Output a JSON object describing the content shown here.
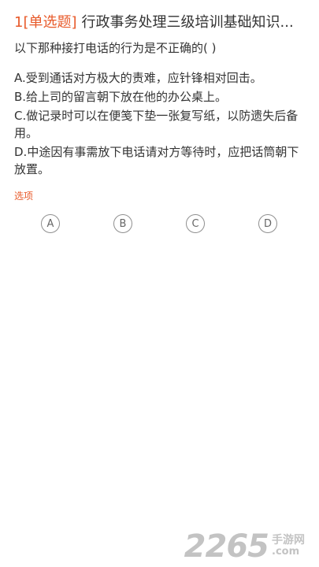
{
  "header": {
    "tag": "1[单选题]",
    "title": "行政事务处理三级培训基础知识..."
  },
  "question": {
    "text": "以下那种接打电话的行为是不正确的( )"
  },
  "options": [
    "A.受到通话对方极大的责难，应针锋相对回击。",
    "B.给上司的留言朝下放在他的办公桌上。",
    "C.做记录时可以在便笺下垫一张复写纸，以防遗失后备用。",
    "D.中途因有事需放下电话请对方等待时，应把话筒朝下放置。"
  ],
  "select_label": "选项",
  "choices": [
    "A",
    "B",
    "C",
    "D"
  ],
  "watermark": {
    "number": "2265",
    "cn": "手游网",
    "domain": ".com"
  },
  "colors": {
    "accent": "#e85a2a",
    "text": "#333333",
    "choice_border": "#8f8f8f",
    "watermark": "#bdbdbd"
  }
}
